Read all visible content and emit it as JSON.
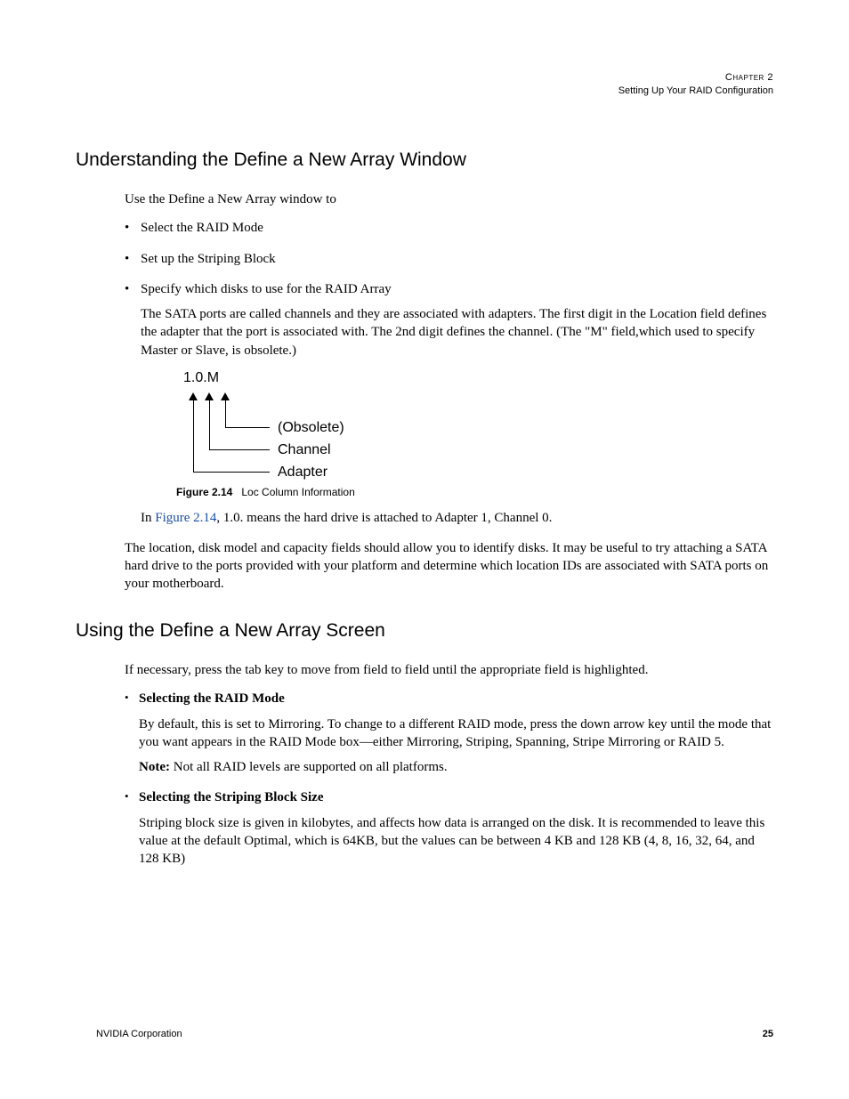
{
  "header": {
    "chapter": "Chapter 2",
    "title": "Setting Up Your RAID Configuration"
  },
  "section1": {
    "heading": "Understanding the Define a New Array Window",
    "intro": "Use the Define a New Array window to",
    "bullets": {
      "b1": "Select the RAID Mode",
      "b2": "Set up the Striping Block",
      "b3": "Specify which disks to use for the RAID Array",
      "b3_para": "The SATA ports are called channels and they are associated with adapters. The first digit in the Location field defines the adapter that the port is associated with. The 2nd digit defines the channel. (The \"M\" field,which used to specify Master or Slave, is obsolete.)"
    },
    "figure": {
      "code": "1.0.M",
      "legend1": "(Obsolete)",
      "legend2": "Channel",
      "legend3": "Adapter",
      "caption_bold": "Figure 2.14",
      "caption_rest": "Loc Column Information"
    },
    "after_fig_pre": "In ",
    "after_fig_ref": "Figure 2.14",
    "after_fig_post": ", 1.0. means the hard drive is attached to Adapter 1, Channel 0.",
    "closing": "The location, disk model and capacity fields should allow you to identify disks. It may be useful to try attaching a SATA hard drive to the ports provided with your platform and determine which location IDs are associated with SATA ports on your motherboard."
  },
  "section2": {
    "heading": "Using the Define a New Array Screen",
    "intro": "If necessary, press the tab key to move from field to field until the appropriate field is highlighted.",
    "items": {
      "i1_title": "Selecting the RAID Mode",
      "i1_body": "By default, this is set to Mirroring. To change to a different RAID mode, press the down arrow key until the mode that you want appears in the RAID Mode box—either Mirroring, Striping, Spanning, Stripe Mirroring or RAID 5.",
      "i1_note_label": "Note:",
      "i1_note_text": " Not all RAID levels are supported on all platforms.",
      "i2_title": "Selecting the Striping Block Size",
      "i2_body": "Striping block size is given in kilobytes, and affects how data is arranged on the disk. It is recommended to leave this value at the default Optimal, which is 64KB, but the values can be between 4 KB and 128 KB (4, 8, 16, 32, 64, and 128 KB)"
    }
  },
  "footer": {
    "left": "NVIDIA Corporation",
    "page": "25"
  }
}
